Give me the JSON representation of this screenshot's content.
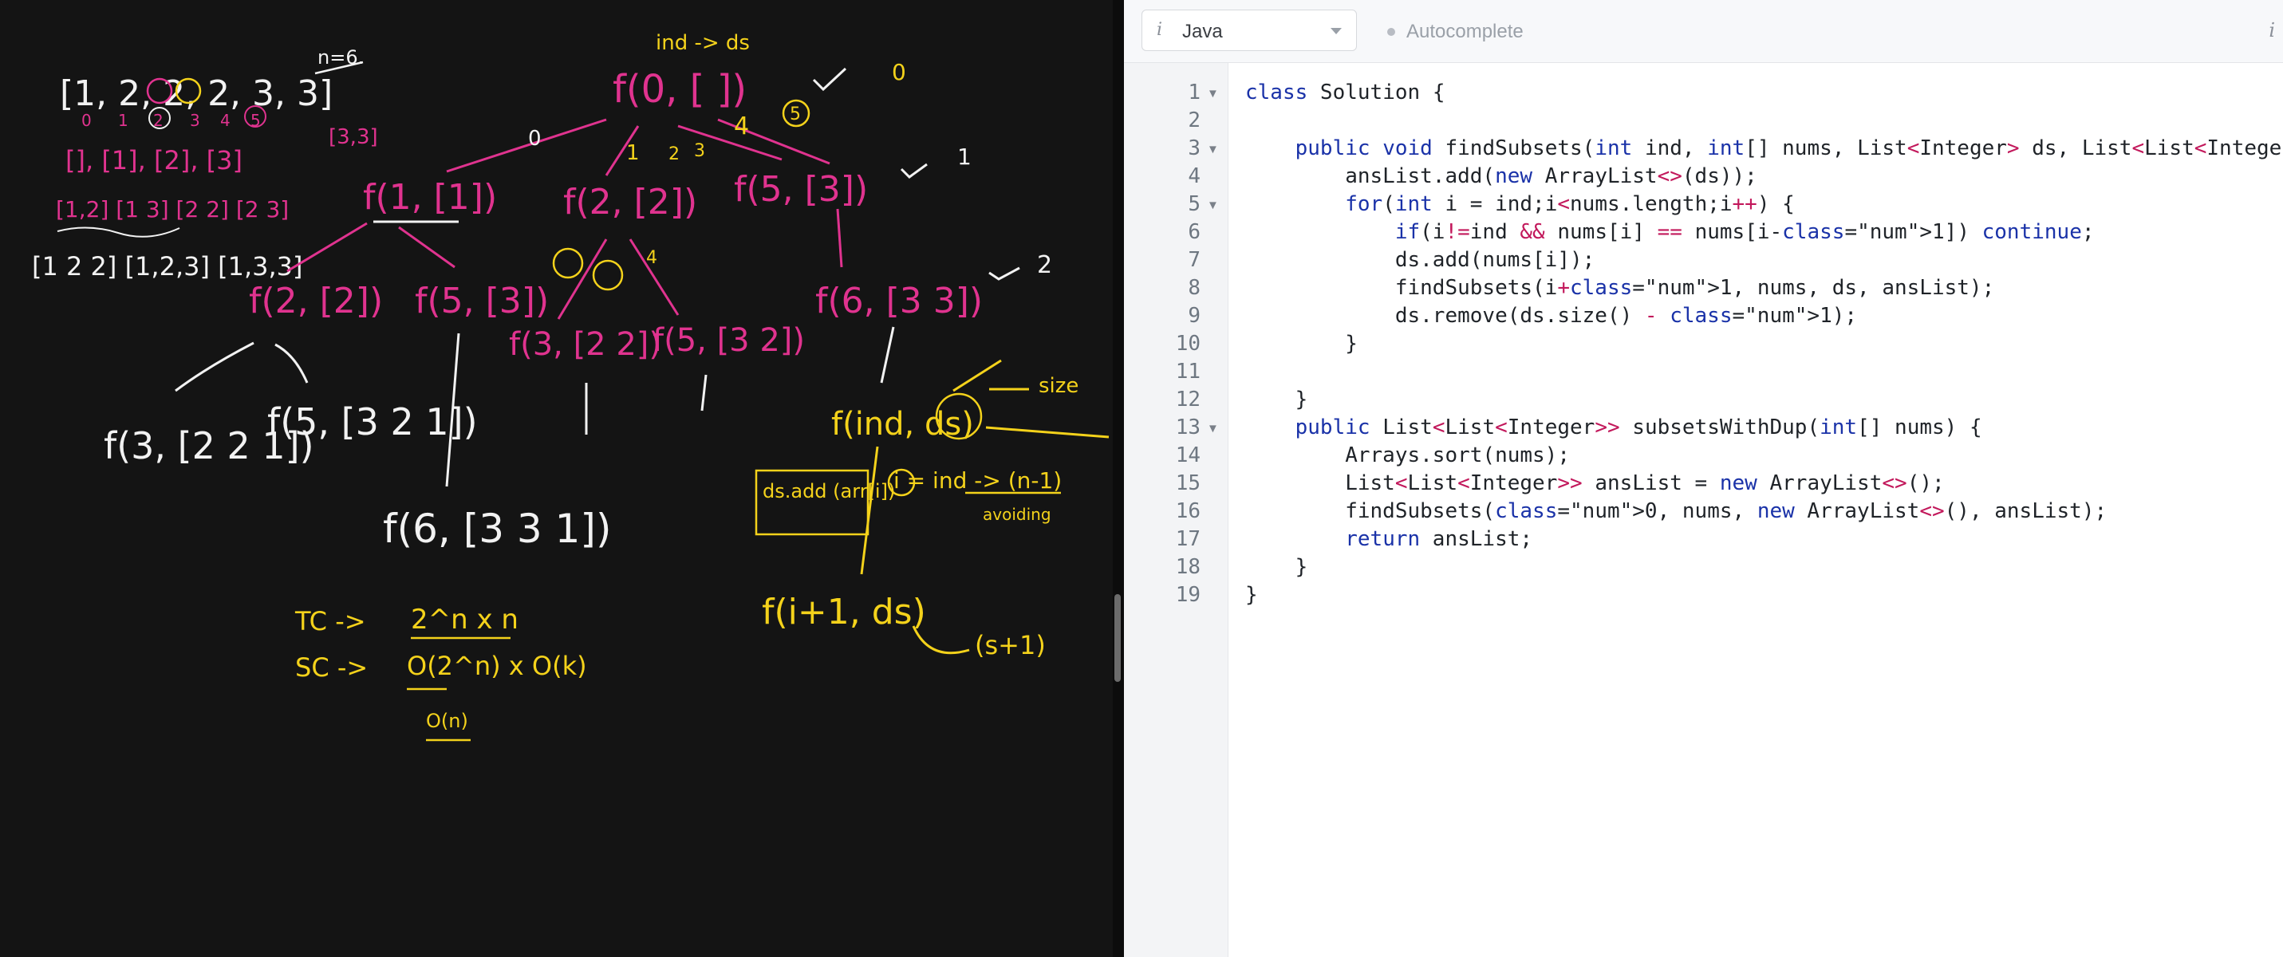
{
  "whiteboard": {
    "top_array": "[1, 2, 2, 2, 3, 3]",
    "n_label": "n=6.",
    "indices": [
      "0",
      "1",
      "2",
      "3",
      "4",
      "5"
    ],
    "partial_subsets": "[], [1], [2], [3]",
    "more_subsets_1": "[1,2] [1 3] [2 2] [2 3]",
    "more_subsets_2": "[1 2 2] [1,2,3] [1,3,3]",
    "small_bracket": "[3,3]",
    "root_call": "f(0, [ ])",
    "ind_ds": "ind -> ds",
    "edge_0": "0",
    "edge_4": "4",
    "edge_1": "1",
    "edge_2": "2",
    "edge_3": "3",
    "circled_5": "5",
    "tick_labels": [
      "0",
      "1",
      "2"
    ],
    "call_f1": "f(1, [1])",
    "call_f2a": "f(2, [2])",
    "call_f5a": "f(5, [3])",
    "call_f2b": "f(2, [2])",
    "call_f5b": "f(5, [3])",
    "call_f6a": "f(6, [3 3])",
    "call_f3a": "f(3, [2 2])",
    "call_f5c": "f(5, [3 2])",
    "call_f3b": "f(3, [2 2 1])",
    "call_f5d": "f(5, [3 2 1])",
    "call_f6b": "f(6, [3 3 1])",
    "sig": "f(ind, ds)",
    "size_label": "size",
    "ds_add": "ds.add (arr[i])",
    "formula": "i = ind -> (n-1)",
    "avoiding": "avoiding",
    "next_call": "f(i+1, ds)",
    "s_plus_1": "(s+1)",
    "tc_label": "TC ->",
    "tc_value": "2^n x n",
    "sc_label": "SC ->",
    "sc_value": "O(2^n) x O(k)",
    "on_label": "O(n)"
  },
  "editor": {
    "language": "Java",
    "autocomplete": "Autocomplete",
    "info_icon": "i",
    "settings_icon": "i",
    "line_numbers": [
      "1",
      "2",
      "3",
      "4",
      "5",
      "6",
      "7",
      "8",
      "9",
      "10",
      "11",
      "12",
      "13",
      "14",
      "15",
      "16",
      "17",
      "18",
      "19"
    ],
    "fold_lines": [
      "1",
      "3",
      "5",
      "13"
    ],
    "code": [
      "class Solution {",
      "",
      "    public void findSubsets(int ind, int[] nums, List<Integer> ds, List<List<Integer>> ansList) {",
      "        ansList.add(new ArrayList<>(ds));",
      "        for(int i = ind;i<nums.length;i++) {",
      "            if(i!=ind && nums[i] == nums[i-1]) continue;",
      "            ds.add(nums[i]);",
      "            findSubsets(i+1, nums, ds, ansList);",
      "            ds.remove(ds.size() - 1);",
      "        }",
      "",
      "    }",
      "    public List<List<Integer>> subsetsWithDup(int[] nums) {",
      "        Arrays.sort(nums);",
      "        List<List<Integer>> ansList = new ArrayList<>();",
      "        findSubsets(0, nums, new ArrayList<>(), ansList);",
      "        return ansList;",
      "    }",
      "}"
    ]
  },
  "colors": {
    "ink_white": "#f2f2f2",
    "ink_pink": "#e0338f",
    "ink_yellow": "#f4d21b",
    "keyword_blue": "#1a32a8",
    "operator_pink": "#c2185b",
    "number_green": "#1a7f37"
  }
}
